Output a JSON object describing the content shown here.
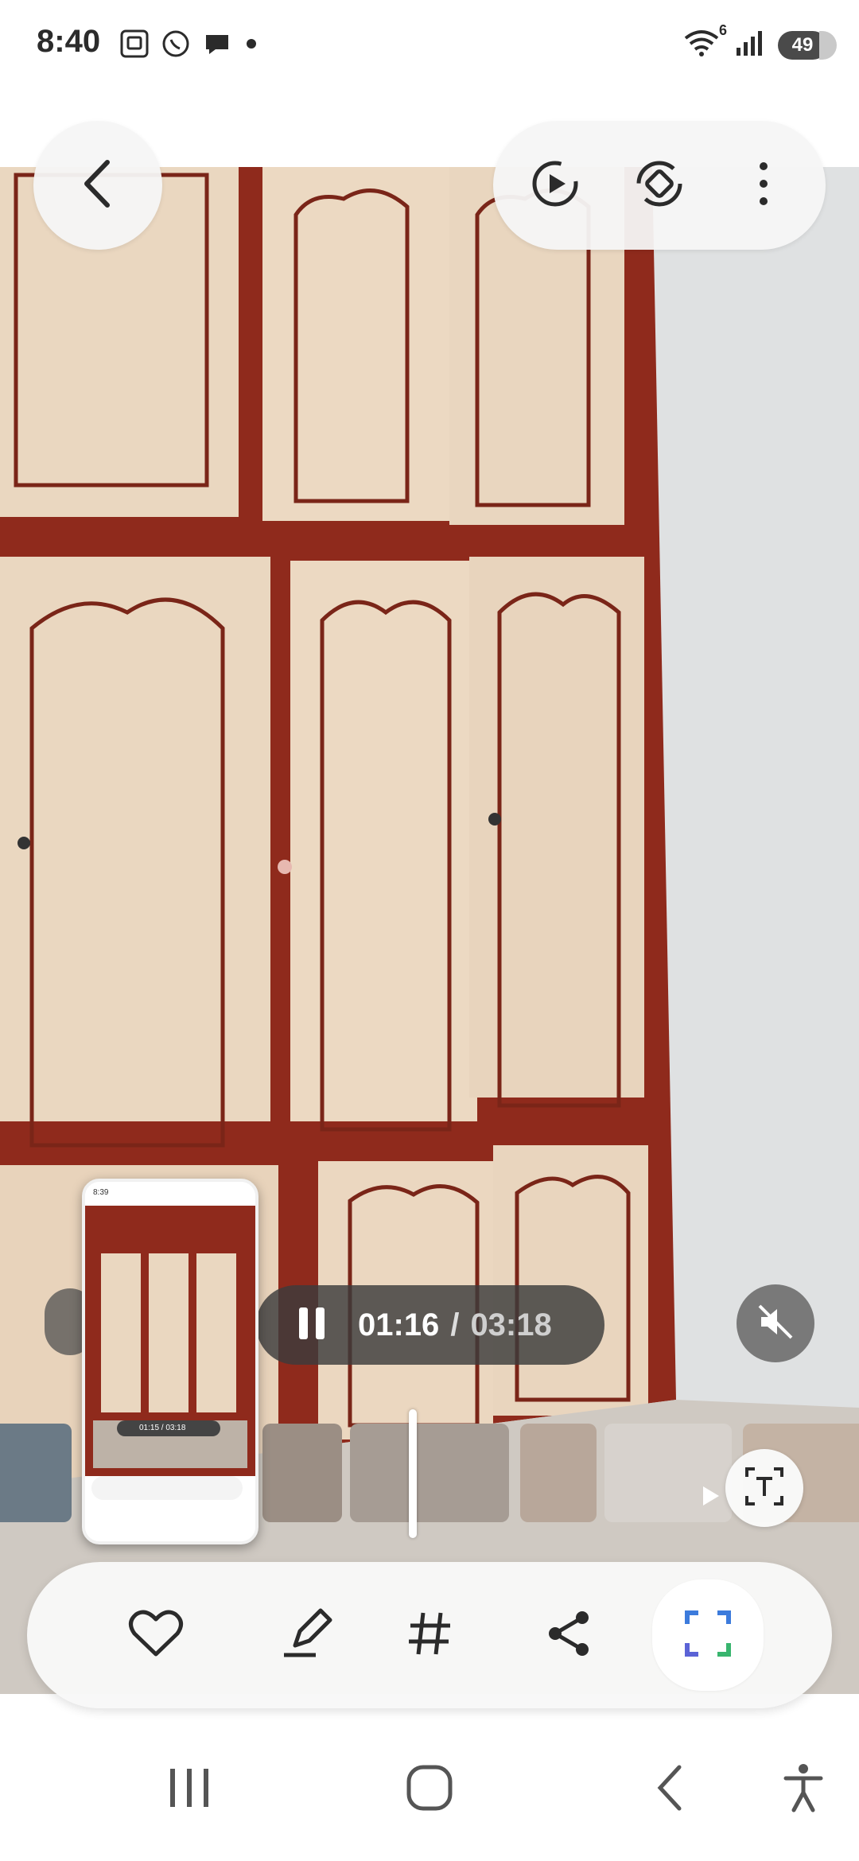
{
  "status_bar": {
    "time": "8:40",
    "battery_level": "49",
    "notification_icons": [
      "screenshot-icon",
      "whatsapp-icon",
      "chat-bubble-icon",
      "dot-icon"
    ],
    "system_icons": [
      "wifi-icon",
      "signal-icon",
      "battery-icon"
    ],
    "wifi_badge": "6"
  },
  "viewer": {
    "back_icon": "chevron-left-icon",
    "top_actions": [
      "motion-play-icon",
      "rotate-icon",
      "more-vert-icon"
    ]
  },
  "playback": {
    "current_time": "01:16",
    "separator": "/",
    "total_time": "03:18",
    "mute_icon": "volume-off-icon"
  },
  "filmstrip": {
    "progress_fraction": 0.4
  },
  "screenshot_preview": {
    "mini_time": "8:39",
    "mini_playback": "01:15 / 03:18"
  },
  "bottom_bar": {
    "actions": [
      "heart-icon",
      "edit-icon",
      "hashtag-icon",
      "share-icon",
      "capture-icon"
    ]
  },
  "colors": {
    "cabinet_frame": "#8f2a1c",
    "cabinet_panel": "#ead7c0",
    "wall": "#d8dbdd",
    "accent_blue": "#3c7bdc",
    "accent_green": "#38b56e"
  }
}
